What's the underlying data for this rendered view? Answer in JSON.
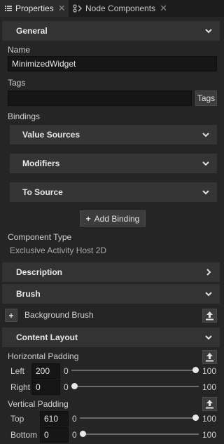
{
  "tabs": [
    {
      "label": "Properties",
      "icon": "list-icon",
      "active": true
    },
    {
      "label": "Node Components",
      "icon": "node-components-icon",
      "active": false
    }
  ],
  "general": {
    "title": "General",
    "name_label": "Name",
    "name_value": "MinimizedWidget",
    "tags_label": "Tags",
    "tags_value": "",
    "tags_button": "Tags",
    "bindings_label": "Bindings",
    "value_sources": "Value Sources",
    "modifiers": "Modifiers",
    "to_source": "To Source",
    "add_binding": "Add Binding",
    "component_type_label": "Component Type",
    "component_type_value": "Exclusive Activity Host 2D"
  },
  "description": {
    "title": "Description"
  },
  "brush": {
    "title": "Brush",
    "background_brush": "Background Brush"
  },
  "content_layout": {
    "title": "Content Layout",
    "horizontal_padding": {
      "label": "Horizontal Padding",
      "left": {
        "label": "Left",
        "value": "200",
        "min": "0",
        "max": "100",
        "level": 1.0
      },
      "right": {
        "label": "Right",
        "value": "0",
        "min": "0",
        "max": "100",
        "level": 0.0
      }
    },
    "vertical_padding": {
      "label": "Vertical Padding",
      "top": {
        "label": "Top",
        "value": "610",
        "min": "0",
        "max": "100",
        "level": 1.0
      },
      "bottom": {
        "label": "Bottom",
        "value": "0",
        "min": "0",
        "max": "100",
        "level": 0.0
      }
    }
  },
  "colors": {
    "background": "#252525",
    "section": "#333333",
    "field": "#161616",
    "text": "#d8d8d8"
  }
}
